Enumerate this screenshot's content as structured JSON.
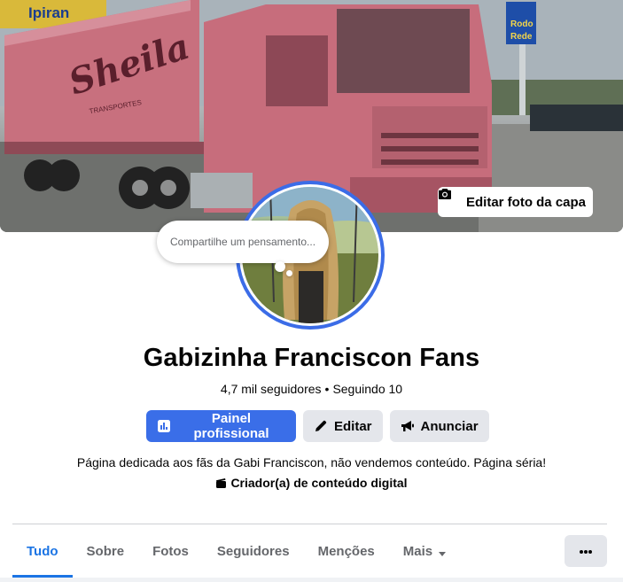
{
  "cover": {
    "edit_cover_label": "Editar foto da capa",
    "trailer_brand_text": "Sheila",
    "trailer_sub_text": "TRANSPORTES",
    "station_sign_text": "Ipiran",
    "road_sign_text_1": "Rodo",
    "road_sign_text_2": "Rede"
  },
  "avatar": {
    "thought_placeholder": "Compartilhe um pensamento..."
  },
  "profile": {
    "name": "Gabizinha Franciscon Fans",
    "followers": "4,7 mil seguidores",
    "separator": "•",
    "following": "Seguindo 10",
    "bio": "Página dedicada aos fãs da Gabi Franciscon, não vendemos conteúdo. Página séria!",
    "category": "Criador(a) de conteúdo digital"
  },
  "actions": {
    "professional_panel": "Painel profissional",
    "edit": "Editar",
    "advertise": "Anunciar"
  },
  "tabs": [
    {
      "label": "Tudo",
      "active": true
    },
    {
      "label": "Sobre",
      "active": false
    },
    {
      "label": "Fotos",
      "active": false
    },
    {
      "label": "Seguidores",
      "active": false
    },
    {
      "label": "Menções",
      "active": false
    },
    {
      "label": "Mais",
      "active": false
    }
  ],
  "colors": {
    "primary": "#3a6ee8",
    "tab_active": "#1b74e4",
    "avatar_ring": "#3b6ce7",
    "truck_pink": "#c9707f"
  },
  "icons": {
    "edit_cover": "camera-icon",
    "professional_panel": "dashboard-icon",
    "edit": "pencil-icon",
    "advertise": "megaphone-icon",
    "category": "clapperboard-icon",
    "more_tab": "caret-down-icon",
    "options": "ellipsis-icon"
  }
}
